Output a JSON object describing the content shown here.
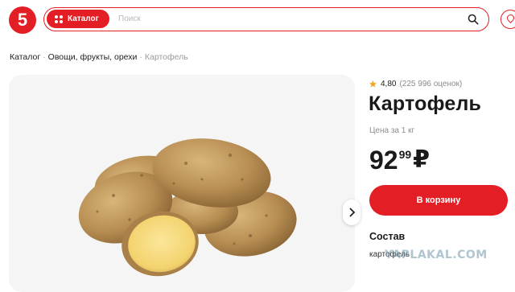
{
  "header": {
    "logo_text": "5",
    "catalog_label": "Каталог",
    "search_placeholder": "Поиск",
    "brand_color": "#e31e24"
  },
  "breadcrumb": {
    "items": [
      "Каталог",
      "Овощи, фрукты, орехи",
      "Картофель"
    ],
    "separator": "·"
  },
  "product": {
    "rating": "4,80",
    "rating_count": "(225 996 оценок)",
    "title": "Картофель",
    "unit_label": "Цена за 1 кг",
    "price_rub": "92",
    "price_kop": "99",
    "currency": "₽",
    "cart_label": "В корзину",
    "composition_title": "Состав",
    "composition_text": "картофель"
  },
  "watermark": "YAPLAKAL.COM",
  "icons": {
    "search": "search-icon",
    "star": "star-icon",
    "next": "chevron-right-icon",
    "location": "location-icon"
  }
}
